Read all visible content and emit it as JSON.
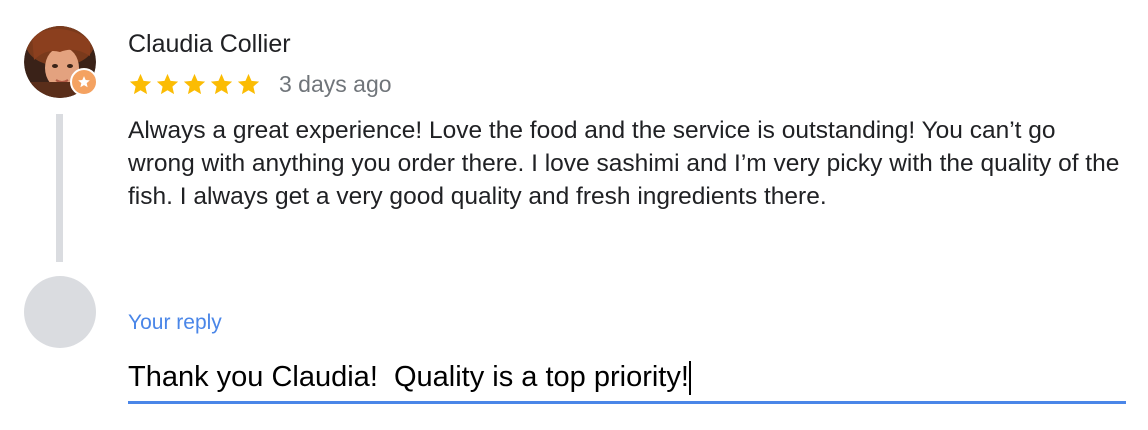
{
  "review": {
    "reviewer_name": "Claudia Collier",
    "rating": 5,
    "max_rating": 5,
    "star_color": "#fbbc04",
    "date": "3 days ago",
    "text": "Always a great experience! Love the food and the service is outstanding! You can’t go wrong with anything you order there. I love sashimi and I’m very picky with the quality of the fish. I always get a very good quality and fresh ingredients there.",
    "avatar_icon": "user-photo",
    "badge_icon": "local-guide-star-icon"
  },
  "reply": {
    "label": "Your reply",
    "value": "Thank you Claudia!  Quality is a top priority!",
    "accent_color": "#4a86e8",
    "avatar_icon": "placeholder-avatar"
  }
}
